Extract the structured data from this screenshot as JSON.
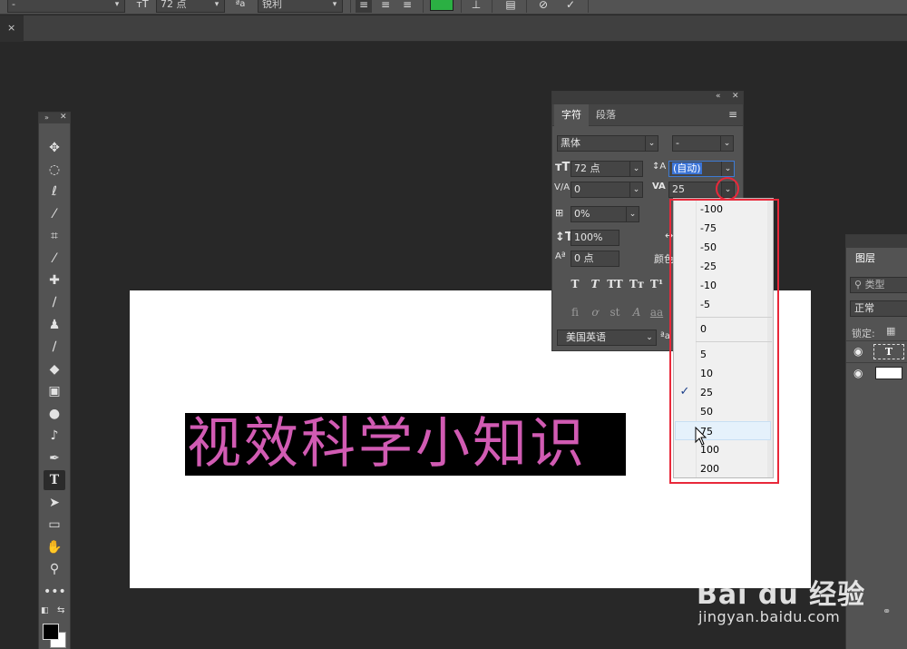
{
  "options_bar": {
    "font_style": "-",
    "font_size": "72 点",
    "antialias": "锐利",
    "text_color": "#2bb043"
  },
  "toolbar": {
    "tools": [
      "move-tool",
      "marquee-tool",
      "lasso-tool",
      "quick-select-tool",
      "crop-tool",
      "eyedropper-tool",
      "healing-tool",
      "brush-tool",
      "stamp-tool",
      "history-brush-tool",
      "eraser-tool",
      "gradient-tool",
      "blur-tool",
      "dodge-tool",
      "pen-tool",
      "type-tool",
      "path-select-tool",
      "shape-tool",
      "hand-tool",
      "zoom-tool",
      "more-tools"
    ],
    "active_tool": "type-tool"
  },
  "canvas": {
    "text": "视效科学小知识",
    "text_color": "#d15bb3"
  },
  "char_panel": {
    "tab_character": "字符",
    "tab_paragraph": "段落",
    "font_family": "黑体",
    "font_style": "-",
    "font_size": "72 点",
    "leading": "(自动)",
    "kerning": "0",
    "tracking": "25",
    "tsume": "0%",
    "vertical_scale": "100%",
    "baseline_shift": "0 点",
    "color_label": "颜色",
    "language": "美国英语",
    "type_buttons": [
      "T",
      "T",
      "TT",
      "Tт",
      "T¹"
    ],
    "ligature_buttons": [
      "fi",
      "ơ",
      "st",
      "A",
      "aa"
    ]
  },
  "tracking_dropdown": {
    "group_negative": [
      "-100",
      "-75",
      "-50",
      "-25",
      "-10",
      "-5"
    ],
    "group_zero": [
      "0"
    ],
    "group_positive": [
      "5",
      "10",
      "25",
      "50",
      "75",
      "100",
      "200"
    ],
    "checked": "25",
    "hovered": "75",
    "check_mark": "✓"
  },
  "layers_panel": {
    "title": "图层",
    "search_placeholder": "类型",
    "blend_mode": "正常",
    "lock_label": "锁定:",
    "text_layer_glyph": "T"
  },
  "watermark": {
    "logo": "Bai du 经验",
    "url": "jingyan.baidu.com"
  }
}
